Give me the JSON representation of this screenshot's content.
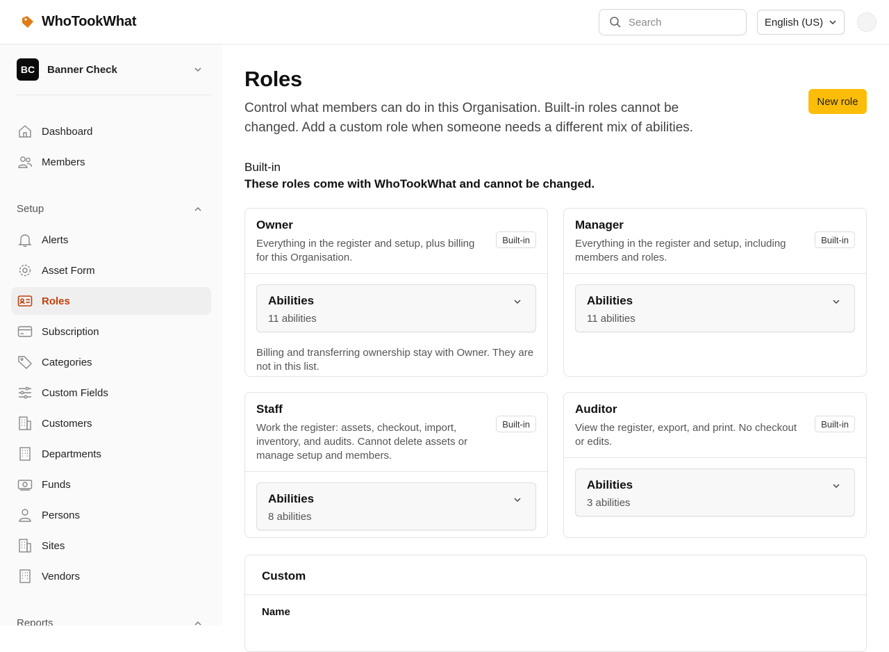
{
  "app": {
    "name": "WhoTookWhat"
  },
  "header": {
    "search_placeholder": "Search",
    "language": "English (US)"
  },
  "org": {
    "initials": "BC",
    "name": "Banner Check"
  },
  "nav": {
    "primary": [
      {
        "label": "Dashboard",
        "icon": "home-icon"
      },
      {
        "label": "Members",
        "icon": "users-icon"
      }
    ],
    "setup_label": "Setup",
    "setup": [
      {
        "label": "Alerts",
        "icon": "bell-icon"
      },
      {
        "label": "Asset Form",
        "icon": "gear-icon"
      },
      {
        "label": "Roles",
        "icon": "id-card-icon"
      },
      {
        "label": "Subscription",
        "icon": "credit-card-icon"
      },
      {
        "label": "Categories",
        "icon": "tag-icon"
      },
      {
        "label": "Custom Fields",
        "icon": "sliders-icon"
      },
      {
        "label": "Customers",
        "icon": "building-icon"
      },
      {
        "label": "Departments",
        "icon": "building-icon"
      },
      {
        "label": "Funds",
        "icon": "banknote-icon"
      },
      {
        "label": "Persons",
        "icon": "person-icon"
      },
      {
        "label": "Sites",
        "icon": "building-icon"
      },
      {
        "label": "Vendors",
        "icon": "building-icon"
      }
    ],
    "reports_label": "Reports",
    "active": "Roles"
  },
  "page": {
    "title": "Roles",
    "subtitle": "Control what members can do in this Organisation. Built-in roles cannot be changed. Add a custom role when someone needs a different mix of abilities.",
    "new_role_label": "New role"
  },
  "builtin": {
    "label": "Built-in",
    "description": "These roles come with WhoTookWhat and cannot be changed.",
    "roles": [
      {
        "name": "Owner",
        "description": "Everything in the register and setup, plus billing for this Organisation.",
        "badge": "Built-in",
        "abilities_label": "Abilities",
        "abilities_count": "11 abilities",
        "note": "Billing and transferring ownership stay with Owner. They are not in this list."
      },
      {
        "name": "Manager",
        "description": "Everything in the register and setup, including members and roles.",
        "badge": "Built-in",
        "abilities_label": "Abilities",
        "abilities_count": "11 abilities",
        "note": ""
      },
      {
        "name": "Staff",
        "description": "Work the register: assets, checkout, import, inventory, and audits. Cannot delete assets or manage setup and members.",
        "badge": "Built-in",
        "abilities_label": "Abilities",
        "abilities_count": "8 abilities",
        "note": ""
      },
      {
        "name": "Auditor",
        "description": "View the register, export, and print. No checkout or edits.",
        "badge": "Built-in",
        "abilities_label": "Abilities",
        "abilities_count": "3 abilities",
        "note": ""
      }
    ]
  },
  "custom": {
    "title": "Custom",
    "column_name": "Name"
  },
  "colors": {
    "accent": "#fbbd08",
    "active_nav": "#c2410c",
    "logo": "#e07b1a"
  }
}
